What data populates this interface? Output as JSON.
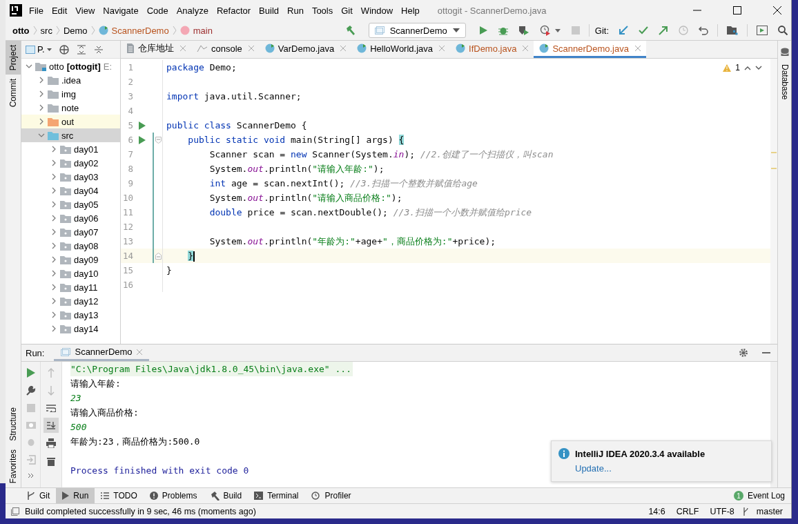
{
  "window": {
    "title": "ottogit - ScannerDemo.java"
  },
  "menu": [
    "File",
    "Edit",
    "View",
    "Navigate",
    "Code",
    "Analyze",
    "Refactor",
    "Build",
    "Run",
    "Tools",
    "Git",
    "Window",
    "Help"
  ],
  "breadcrumb": [
    {
      "label": "otto",
      "kind": "project"
    },
    {
      "label": "src",
      "kind": "folder"
    },
    {
      "label": "Demo",
      "kind": "folder"
    },
    {
      "label": "ScannerDemo",
      "kind": "class"
    },
    {
      "label": "main",
      "kind": "method"
    }
  ],
  "run_config": "ScannerDemo",
  "git_label": "Git:",
  "left_stripe": [
    {
      "label": "Project",
      "selected": true
    },
    {
      "label": "Commit",
      "selected": false
    }
  ],
  "left_stripe_bottom": [
    {
      "label": "Structure"
    },
    {
      "label": "Favorites"
    }
  ],
  "right_stripe": [
    {
      "label": "Database"
    }
  ],
  "project": {
    "title": "P.",
    "tree": [
      {
        "label": "otto",
        "tag": "[ottogit]",
        "path": "E:",
        "kind": "module",
        "expanded": true,
        "selected": false,
        "children": [
          {
            "label": ".idea",
            "kind": "folder",
            "expanded": false,
            "selected": false
          },
          {
            "label": "img",
            "kind": "folder",
            "expanded": false,
            "selected": false
          },
          {
            "label": "note",
            "kind": "folder",
            "expanded": false,
            "selected": false
          },
          {
            "label": "out",
            "kind": "excluded",
            "expanded": false,
            "selected": false
          },
          {
            "label": "src",
            "kind": "source",
            "expanded": true,
            "selected": true,
            "children": [
              {
                "label": "day01",
                "kind": "package",
                "expanded": false,
                "selected": false
              },
              {
                "label": "day02",
                "kind": "package",
                "expanded": false,
                "selected": false
              },
              {
                "label": "day03",
                "kind": "package",
                "expanded": false,
                "selected": false
              },
              {
                "label": "day04",
                "kind": "package",
                "expanded": false,
                "selected": false
              },
              {
                "label": "day05",
                "kind": "package",
                "expanded": false,
                "selected": false
              },
              {
                "label": "day06",
                "kind": "package",
                "expanded": false,
                "selected": false
              },
              {
                "label": "day07",
                "kind": "package",
                "expanded": false,
                "selected": false
              },
              {
                "label": "day08",
                "kind": "package",
                "expanded": false,
                "selected": false
              },
              {
                "label": "day09",
                "kind": "package",
                "expanded": false,
                "selected": false
              },
              {
                "label": "day10",
                "kind": "package",
                "expanded": false,
                "selected": false
              },
              {
                "label": "day11",
                "kind": "package",
                "expanded": false,
                "selected": false
              },
              {
                "label": "day12",
                "kind": "package",
                "expanded": false,
                "selected": false
              },
              {
                "label": "day13",
                "kind": "package",
                "expanded": false,
                "selected": false
              },
              {
                "label": "day14",
                "kind": "package",
                "expanded": false,
                "selected": false
              }
            ]
          }
        ]
      }
    ]
  },
  "editor_tabs": [
    {
      "label": "仓库地址",
      "kind": "text",
      "selected": false,
      "untracked": false
    },
    {
      "label": "console",
      "kind": "console",
      "selected": false,
      "untracked": false
    },
    {
      "label": "VarDemo.java",
      "kind": "class",
      "selected": false,
      "untracked": false
    },
    {
      "label": "HelloWorld.java",
      "kind": "class",
      "selected": false,
      "untracked": false
    },
    {
      "label": "IfDemo.java",
      "kind": "class",
      "selected": false,
      "untracked": true
    },
    {
      "label": "ScannerDemo.java",
      "kind": "class",
      "selected": true,
      "untracked": true
    }
  ],
  "warnings": "1",
  "code": [
    {
      "number": "1",
      "kind": "plain",
      "run": false,
      "changed": false,
      "current": false,
      "tokens": [
        {
          "kind": "kw",
          "text": "package"
        },
        {
          "kind": "txt",
          "text": " Demo;"
        }
      ]
    },
    {
      "number": "2",
      "kind": "plain",
      "run": false,
      "changed": false,
      "current": false
    },
    {
      "number": "3",
      "kind": "plain",
      "run": false,
      "changed": false,
      "current": false,
      "tokens": [
        {
          "kind": "kw",
          "text": "import"
        },
        {
          "kind": "txt",
          "text": " java.util.Scanner;"
        }
      ]
    },
    {
      "number": "4",
      "kind": "plain",
      "run": false,
      "changed": false,
      "current": false
    },
    {
      "number": "5",
      "kind": "plain",
      "run": true,
      "changed": false,
      "current": false,
      "tokens": [
        {
          "kind": "kw",
          "text": "public class"
        },
        {
          "kind": "txt",
          "text": " ScannerDemo {"
        }
      ]
    },
    {
      "number": "6",
      "kind": "fold-start",
      "run": true,
      "changed": true,
      "current": false,
      "tokens": [
        {
          "kind": "kw",
          "text": "    public static void"
        },
        {
          "kind": "txt",
          "text": " main(String[] args) "
        },
        {
          "kind": "brace",
          "text": "{"
        }
      ]
    },
    {
      "number": "7",
      "kind": "plain",
      "run": false,
      "changed": true,
      "current": false,
      "tokens": [
        {
          "kind": "txt",
          "text": "        Scanner scan = "
        },
        {
          "kind": "kw",
          "text": "new"
        },
        {
          "kind": "txt",
          "text": " Scanner(System."
        },
        {
          "kind": "fld",
          "text": "in"
        },
        {
          "kind": "txt",
          "text": "); "
        },
        {
          "kind": "cmt",
          "text": "//2.创建了一个扫描仪，叫scan"
        }
      ]
    },
    {
      "number": "8",
      "kind": "plain",
      "run": false,
      "changed": true,
      "current": false,
      "tokens": [
        {
          "kind": "txt",
          "text": "        System."
        },
        {
          "kind": "fld",
          "text": "out"
        },
        {
          "kind": "txt",
          "text": ".println("
        },
        {
          "kind": "str",
          "text": "\"请输入年龄:\""
        },
        {
          "kind": "txt",
          "text": ");"
        }
      ]
    },
    {
      "number": "9",
      "kind": "plain",
      "run": false,
      "changed": true,
      "current": false,
      "tokens": [
        {
          "kind": "kw",
          "text": "        int"
        },
        {
          "kind": "txt",
          "text": " age = scan.nextInt(); "
        },
        {
          "kind": "cmt",
          "text": "//3.扫描一个整数并赋值给age"
        }
      ]
    },
    {
      "number": "10",
      "kind": "plain",
      "run": false,
      "changed": true,
      "current": false,
      "tokens": [
        {
          "kind": "txt",
          "text": "        System."
        },
        {
          "kind": "fld",
          "text": "out"
        },
        {
          "kind": "txt",
          "text": ".println("
        },
        {
          "kind": "str",
          "text": "\"请输入商品价格:\""
        },
        {
          "kind": "txt",
          "text": ");"
        }
      ]
    },
    {
      "number": "11",
      "kind": "plain",
      "run": false,
      "changed": true,
      "current": false,
      "tokens": [
        {
          "kind": "kw",
          "text": "        double"
        },
        {
          "kind": "txt",
          "text": " price = scan.nextDouble(); "
        },
        {
          "kind": "cmt",
          "text": "//3.扫描一个小数并赋值给price"
        }
      ]
    },
    {
      "number": "12",
      "kind": "plain",
      "run": false,
      "changed": true,
      "current": false
    },
    {
      "number": "13",
      "kind": "plain",
      "run": false,
      "changed": true,
      "current": false,
      "tokens": [
        {
          "kind": "txt",
          "text": "        System."
        },
        {
          "kind": "fld",
          "text": "out"
        },
        {
          "kind": "txt",
          "text": ".println("
        },
        {
          "kind": "str",
          "text": "\"年龄为:\""
        },
        {
          "kind": "txt",
          "text": "+age+"
        },
        {
          "kind": "str",
          "text": "\"，商品价格为:\""
        },
        {
          "kind": "txt",
          "text": "+price);"
        }
      ]
    },
    {
      "number": "14",
      "kind": "fold-end",
      "run": false,
      "changed": true,
      "current": true,
      "tokens": [
        {
          "kind": "brace",
          "text": "    }"
        }
      ]
    },
    {
      "number": "15",
      "kind": "plain",
      "run": false,
      "changed": false,
      "current": false,
      "tokens": [
        {
          "kind": "txt",
          "text": "}"
        }
      ]
    },
    {
      "number": "16",
      "kind": "plain",
      "run": false,
      "changed": false,
      "current": false
    }
  ],
  "run": {
    "label": "Run:",
    "tab": "ScannerDemo",
    "console": [
      {
        "kind": "command",
        "text": "\"C:\\Program Files\\Java\\jdk1.8.0_45\\bin\\java.exe\" ..."
      },
      {
        "kind": "output",
        "text": "请输入年龄:"
      },
      {
        "kind": "input",
        "text": "23"
      },
      {
        "kind": "output",
        "text": "请输入商品价格:"
      },
      {
        "kind": "input",
        "text": "500"
      },
      {
        "kind": "output",
        "text": "年龄为:23，商品价格为:500.0"
      },
      {
        "kind": "system",
        "text": "Process finished with exit code 0"
      }
    ]
  },
  "notification": {
    "title": "IntelliJ IDEA 2020.3.4 available",
    "action": "Update..."
  },
  "tool_windows": [
    {
      "label": "Git",
      "kind": "git",
      "selected": false
    },
    {
      "label": "Run",
      "kind": "run",
      "selected": true
    },
    {
      "label": "TODO",
      "kind": "todo",
      "selected": false
    },
    {
      "label": "Problems",
      "kind": "problems",
      "selected": false
    },
    {
      "label": "Build",
      "kind": "build",
      "selected": false
    },
    {
      "label": "Terminal",
      "kind": "terminal",
      "selected": false
    },
    {
      "label": "Profiler",
      "kind": "profiler",
      "selected": false
    }
  ],
  "event_log": {
    "label": "Event Log",
    "count": "1"
  },
  "status_bar": {
    "message": "Build completed successfully in 9 sec, 46 ms (moments ago)",
    "position": "14:6",
    "line_separator": "CRLF",
    "encoding": "UTF-8",
    "branch": "master"
  }
}
